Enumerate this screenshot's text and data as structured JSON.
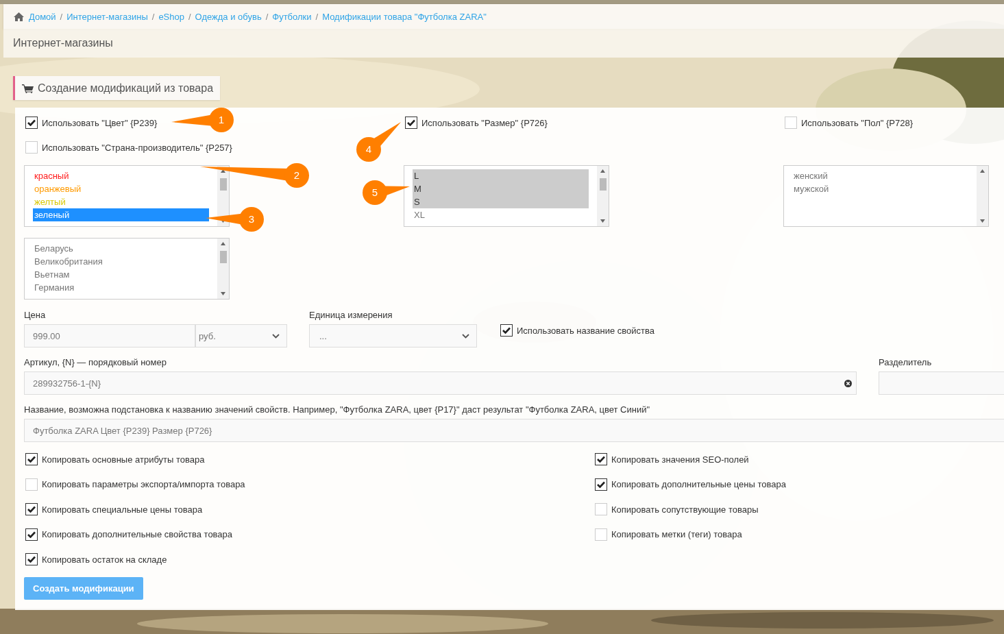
{
  "breadcrumbs": [
    {
      "label": "Домой",
      "kind": "home"
    },
    {
      "separator": "/",
      "label": "Интернет-магазины",
      "kind": "link"
    },
    {
      "separator": "/",
      "label": "eShop",
      "kind": "link"
    },
    {
      "separator": "/",
      "label": "Одежда и обувь",
      "kind": "link"
    },
    {
      "separator": "/",
      "label": "Футболки",
      "kind": "link"
    },
    {
      "separator": "/",
      "label": "Модификации товара \"Футболка ZARA\"",
      "kind": "link"
    }
  ],
  "page_title": "Интернет-магазины",
  "panel_tab": {
    "label": "Создание модификаций из товара"
  },
  "properties": [
    {
      "label": "Использовать \"Цвет\" {P239}",
      "checked": true,
      "options": [
        {
          "label": "красный",
          "selected": false,
          "color": "#ff1a1a"
        },
        {
          "label": "оранжевый",
          "selected": false,
          "color": "#ff9a00"
        },
        {
          "label": "желтый",
          "selected": false,
          "color": "#d9c800"
        },
        {
          "label": "зеленый",
          "selected": true
        }
      ]
    },
    {
      "label": "Использовать \"Размер\" {P726}",
      "checked": true,
      "options": [
        {
          "label": "L",
          "selected": true
        },
        {
          "label": "M",
          "selected": true
        },
        {
          "label": "S",
          "selected": true
        },
        {
          "label": "XL",
          "selected": false
        }
      ]
    },
    {
      "label": "Использовать \"Пол\" {P728}",
      "checked": false,
      "options": [
        {
          "label": "женский",
          "selected": false
        },
        {
          "label": "мужской",
          "selected": false
        }
      ]
    },
    {
      "label": "Использовать \"Страна-производитель\" {P257}",
      "checked": false,
      "options": [
        {
          "label": "Беларусь",
          "selected": false
        },
        {
          "label": "Великобритания",
          "selected": false
        },
        {
          "label": "Вьетнам",
          "selected": false
        },
        {
          "label": "Германия",
          "selected": false
        }
      ]
    }
  ],
  "price": {
    "label": "Цена",
    "value": "999.00",
    "currency": "руб."
  },
  "unit": {
    "label": "Единица измерения",
    "value": "..."
  },
  "use_property_name": {
    "label": "Использовать название свойства",
    "checked": true
  },
  "article": {
    "label": "Артикул, {N} — порядковый номер",
    "value": "289932756-1-{N}"
  },
  "separator": {
    "label": "Разделитель"
  },
  "name": {
    "label": "Название, возможна подстановка к названию значений свойств. Например, \"Футболка ZARA, цвет {P17}\" даст результат \"Футболка ZARA, цвет Синий\"",
    "value": "Футболка ZARA Цвет {P239} Размер {P726}"
  },
  "copy_options": [
    {
      "label": "Копировать основные атрибуты товара",
      "checked": true
    },
    {
      "label": "Копировать параметры экспорта/импорта товара",
      "checked": false
    },
    {
      "label": "Копировать специальные цены товара",
      "checked": true
    },
    {
      "label": "Копировать дополнительные свойства товара",
      "checked": true
    },
    {
      "label": "Копировать остаток на складе",
      "checked": true
    },
    {
      "label": "Копировать значения SEO-полей",
      "checked": true
    },
    {
      "label": "Копировать дополнительные цены товара",
      "checked": true
    },
    {
      "label": "Копировать сопутствующие товары",
      "checked": false
    },
    {
      "label": "Копировать метки (теги) товара",
      "checked": false
    }
  ],
  "submit_button": "Создать модификации",
  "callouts": [
    "1",
    "2",
    "3",
    "4",
    "5"
  ]
}
